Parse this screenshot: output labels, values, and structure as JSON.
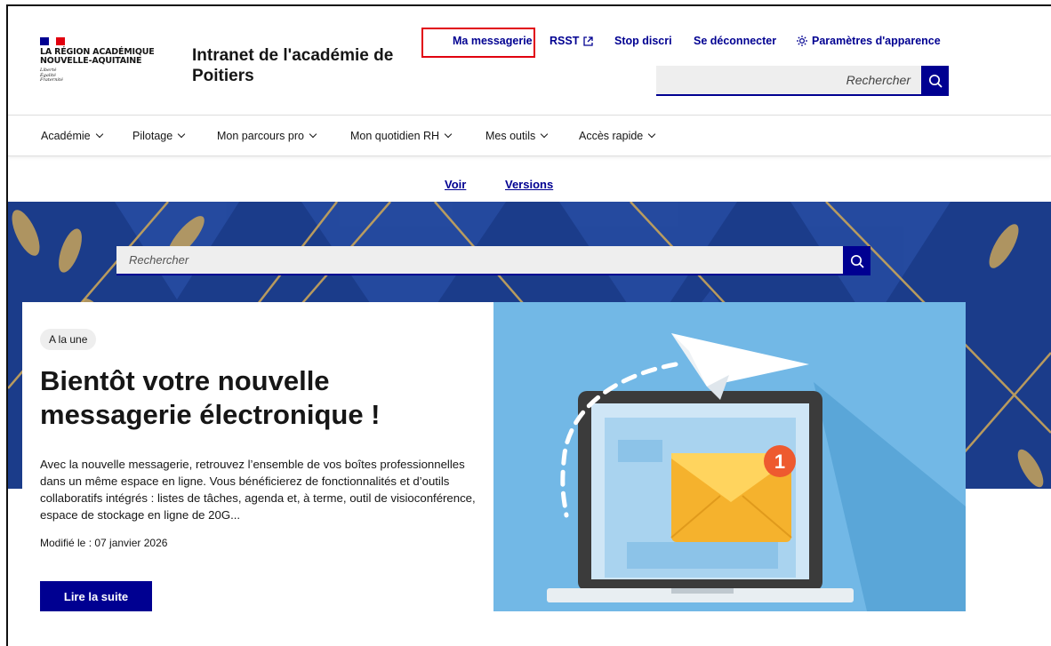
{
  "brand": {
    "logo_line1": "LA RÉGION ACADÉMIQUE",
    "logo_line2": "NOUVELLE-AQUITAINE",
    "motto_1": "Liberté",
    "motto_2": "Égalité",
    "motto_3": "Fraternité",
    "site_title": "Intranet de l'académie de Poitiers"
  },
  "tools": {
    "messagerie": "Ma messagerie",
    "rsst": "RSST",
    "stop_discri": "Stop discri",
    "logout": "Se déconnecter",
    "appearance": "Paramètres d'apparence"
  },
  "search_top": {
    "placeholder": "Rechercher"
  },
  "nav": [
    {
      "label": "Académie"
    },
    {
      "label": "Pilotage"
    },
    {
      "label": "Mon parcours pro"
    },
    {
      "label": "Mon quotidien RH"
    },
    {
      "label": "Mes outils"
    },
    {
      "label": "Accès rapide"
    }
  ],
  "tabs": {
    "view": "Voir",
    "versions": "Versions"
  },
  "search_mid": {
    "placeholder": "Rechercher"
  },
  "featured": {
    "badge": "A la une",
    "title": "Bientôt votre nouvelle messagerie électronique !",
    "text": "Avec la nouvelle messagerie, retrouvez l’ensemble de vos boîtes professionnelles dans un même espace en ligne. Vous bénéficierez de fonctionnalités et d’outils collaboratifs intégrés : listes de tâches, agenda et, à terme, outil de visioconférence, espace de stockage en ligne de 20G...",
    "date": "Modifié le : 07 janvier 2026",
    "read_more": "Lire la suite",
    "notification_count": "1"
  },
  "colors": {
    "primary": "#000091",
    "highlight": "#e1000f",
    "banner": "#1a3a86",
    "illustration_bg": "#72b8e6"
  }
}
